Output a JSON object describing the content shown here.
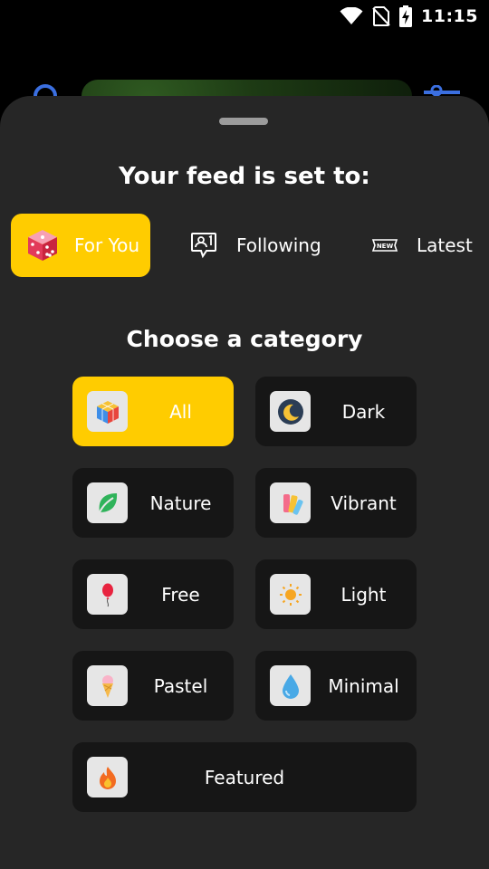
{
  "status_bar": {
    "time": "11:15",
    "icons": [
      "wifi-icon",
      "no-sim-icon",
      "battery-charging-icon"
    ]
  },
  "background": {
    "icons": [
      "search-icon",
      "filter-icon"
    ]
  },
  "sheet": {
    "title": "Your feed is set to:",
    "feed_options": [
      {
        "label": "For You",
        "icon": "dice-icon",
        "selected": true
      },
      {
        "label": "Following",
        "icon": "following-icon",
        "selected": false
      },
      {
        "label": "Latest",
        "icon": "new-badge-icon",
        "selected": false
      }
    ],
    "category_title": "Choose a category",
    "categories": [
      {
        "label": "All",
        "icon": "cube-icon",
        "selected": true
      },
      {
        "label": "Dark",
        "icon": "moon-icon",
        "selected": false
      },
      {
        "label": "Nature",
        "icon": "leaf-icon",
        "selected": false
      },
      {
        "label": "Vibrant",
        "icon": "color-palette-icon",
        "selected": false
      },
      {
        "label": "Free",
        "icon": "balloon-icon",
        "selected": false
      },
      {
        "label": "Light",
        "icon": "sun-icon",
        "selected": false
      },
      {
        "label": "Pastel",
        "icon": "ice-cream-icon",
        "selected": false
      },
      {
        "label": "Minimal",
        "icon": "droplet-icon",
        "selected": false
      },
      {
        "label": "Featured",
        "icon": "fire-icon",
        "selected": false
      }
    ]
  },
  "colors": {
    "accent": "#ffcc00",
    "sheet_background": "#262626",
    "button_background": "#161616",
    "icon_tile": "#e6e6e6"
  }
}
